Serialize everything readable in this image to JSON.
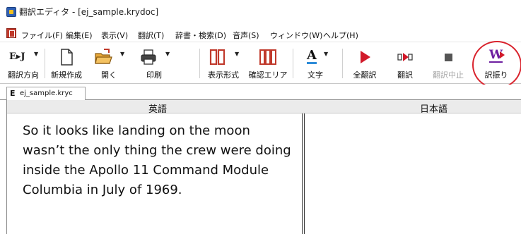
{
  "window": {
    "title": "翻訳エディタ - [ej_sample.krydoc]"
  },
  "menu": [
    {
      "label": "ファイル(F)"
    },
    {
      "label": "編集(E)"
    },
    {
      "label": "表示(V)"
    },
    {
      "label": "翻訳(T)"
    },
    {
      "label": "辞書・検索(D)"
    },
    {
      "label": "音声(S)"
    },
    {
      "label": "ウィンドウ(W)"
    },
    {
      "label": "ヘルプ(H)"
    }
  ],
  "toolbar": {
    "direction_icon": "E▸J",
    "direction_label": "翻訳方向",
    "new_label": "新規作成",
    "open_label": "開く",
    "print_label": "印刷",
    "display_label": "表示形式",
    "confirm_label": "確認エリア",
    "font_icon": "A",
    "font_label": "文字",
    "translate_all_label": "全翻訳",
    "translate_label": "翻訳",
    "stop_label": "翻訳中止",
    "annotate_icon": "W",
    "annotate_label": "訳振り"
  },
  "tabs": [
    {
      "icon": "E",
      "label": "ej_sample.kryc"
    }
  ],
  "editor": {
    "source_header": "英語",
    "target_header": "日本語",
    "source_text": "So it looks like landing on the moon wasn’t the only thing the crew were doing inside the Apollo 11 Command Module Columbia in July of 1969.",
    "target_text": ""
  },
  "colors": {
    "play_red": "#d11a2a",
    "circle_red": "#d9232d",
    "toolbar_disabled": "#a6a6a6"
  }
}
